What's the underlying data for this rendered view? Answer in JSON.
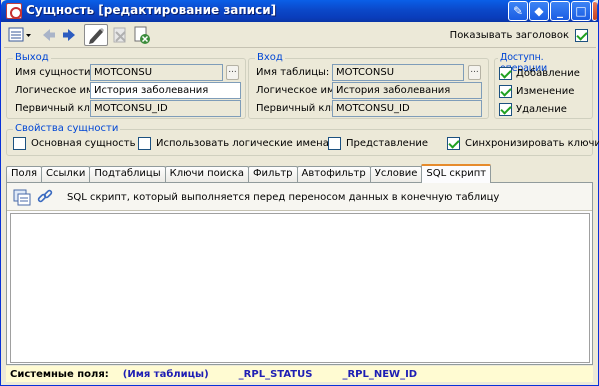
{
  "window": {
    "title": "Сущность [редактирование записи]"
  },
  "toolbar": {
    "show_header_label": "Показывать заголовок",
    "show_header_checked": true
  },
  "output_group": {
    "title": "Выход",
    "entity_name_label": "Имя сущности:",
    "entity_name_value": "MOTCONSU",
    "logical_name_label": "Логическое имя:",
    "logical_name_value": "История заболевания",
    "primary_key_label": "Первичный ключ:",
    "primary_key_value": "MOTCONSU_ID",
    "ellipsis": "..."
  },
  "input_group": {
    "title": "Вход",
    "table_name_label": "Имя таблицы:",
    "table_name_value": "MOTCONSU",
    "logical_name_label": "Логическое имя:",
    "logical_name_value": "История заболевания",
    "primary_key_label": "Первичный ключ:",
    "primary_key_value": "MOTCONSU_ID",
    "ellipsis": "..."
  },
  "operations_group": {
    "title": "Доступн. операции",
    "items": [
      {
        "label": "Добавление",
        "checked": true
      },
      {
        "label": "Изменение",
        "checked": true
      },
      {
        "label": "Удаление",
        "checked": true
      }
    ]
  },
  "properties_group": {
    "title": "Свойства сущности",
    "items": [
      {
        "label": "Основная сущность",
        "checked": false
      },
      {
        "label": "Использовать логические имена",
        "checked": false
      },
      {
        "label": "Представление",
        "checked": false
      },
      {
        "label": "Синхронизировать ключи",
        "checked": true
      }
    ]
  },
  "tabs": [
    {
      "label": "Поля"
    },
    {
      "label": "Ссылки"
    },
    {
      "label": "Подтаблицы"
    },
    {
      "label": "Ключи поиска"
    },
    {
      "label": "Фильтр"
    },
    {
      "label": "Автофильтр"
    },
    {
      "label": "Условие"
    },
    {
      "label": "SQL скрипт",
      "active": true
    }
  ],
  "panel": {
    "description": "SQL скрипт, который выполняется перед переносом данных в конечную таблицу",
    "editor_content": ""
  },
  "statusbar": {
    "label": "Системные поля:",
    "fields": [
      "(Имя таблицы)",
      "_RPL_STATUS",
      "_RPL_NEW_ID"
    ]
  },
  "colors": {
    "titlebar": "#0a4fd8",
    "group_title": "#0046d5",
    "active_tab_accent": "#e68b2c",
    "system_field": "#1e1eb4",
    "statusbar_bg": "#fffbd2"
  }
}
